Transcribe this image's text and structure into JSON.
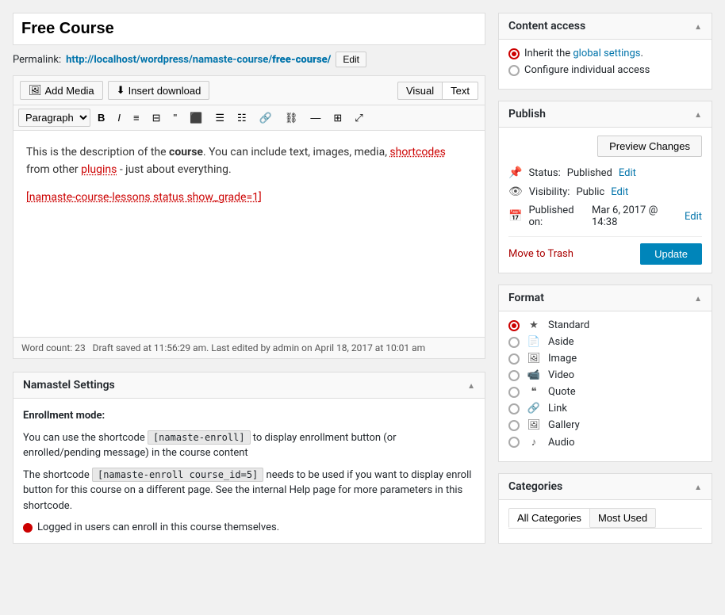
{
  "page": {
    "title": "Free Course"
  },
  "permalink": {
    "label": "Permalink:",
    "url_prefix": "http://localhost/wordpress/namaste-course/",
    "url_bold": "free-course/",
    "edit_btn": "Edit"
  },
  "editor": {
    "add_media_btn": "Add Media",
    "insert_download_btn": "Insert download",
    "visual_btn": "Visual",
    "text_btn": "Text",
    "paragraph_select": "Paragraph",
    "content_html": "This is the description of the <strong>course</strong>. You can include text, images, media, shortcodes from other plugins - just about everything.",
    "shortcode_line": "[namaste-course-lessons status show_grade=1]"
  },
  "status_bar": {
    "word_count_label": "Word count:",
    "word_count": "23",
    "draft_saved": "Draft saved at 11:56:29 am. Last edited by admin on April 18, 2017 at 10:01 am"
  },
  "namastel": {
    "title": "Namastel Settings",
    "enrollment_label": "Enrollment mode:",
    "shortcode_text1": "You can use the shortcode",
    "shortcode1": "[namaste-enroll]",
    "shortcode_text2": "to display enrollment button (or enrolled/pending message) in the course content",
    "shortcode_text3": "The shortcode",
    "shortcode2": "[namaste-enroll course_id=5]",
    "shortcode_text4": "needs to be used if you want to display enroll button for this course on a different page. See the internal Help page for more parameters in this shortcode.",
    "logged_in_text": "Logged in users can enroll in this course themselves."
  },
  "content_access": {
    "title": "Content access",
    "option1": "Inherit the",
    "option1_link": "global settings",
    "option1_suffix": ".",
    "option2": "Configure individual access"
  },
  "publish": {
    "title": "Publish",
    "preview_btn": "Preview Changes",
    "status_label": "Status:",
    "status_value": "Published",
    "status_edit": "Edit",
    "visibility_label": "Visibility:",
    "visibility_value": "Public",
    "visibility_edit": "Edit",
    "published_label": "Published on:",
    "published_value": "Mar 6, 2017 @ 14:38",
    "published_edit": "Edit",
    "move_to_trash": "Move to Trash",
    "update_btn": "Update"
  },
  "format": {
    "title": "Format",
    "options": [
      {
        "id": "standard",
        "label": "Standard",
        "icon": "★",
        "checked": true
      },
      {
        "id": "aside",
        "label": "Aside",
        "icon": "📄",
        "checked": false
      },
      {
        "id": "image",
        "label": "Image",
        "icon": "🖼",
        "checked": false
      },
      {
        "id": "video",
        "label": "Video",
        "icon": "📹",
        "checked": false
      },
      {
        "id": "quote",
        "label": "Quote",
        "icon": "❝",
        "checked": false
      },
      {
        "id": "link",
        "label": "Link",
        "icon": "🔗",
        "checked": false
      },
      {
        "id": "gallery",
        "label": "Gallery",
        "icon": "🖼",
        "checked": false
      },
      {
        "id": "audio",
        "label": "Audio",
        "icon": "♪",
        "checked": false
      }
    ]
  },
  "categories": {
    "title": "Categories",
    "tab_all": "All Categories",
    "tab_most_used": "Most Used"
  }
}
